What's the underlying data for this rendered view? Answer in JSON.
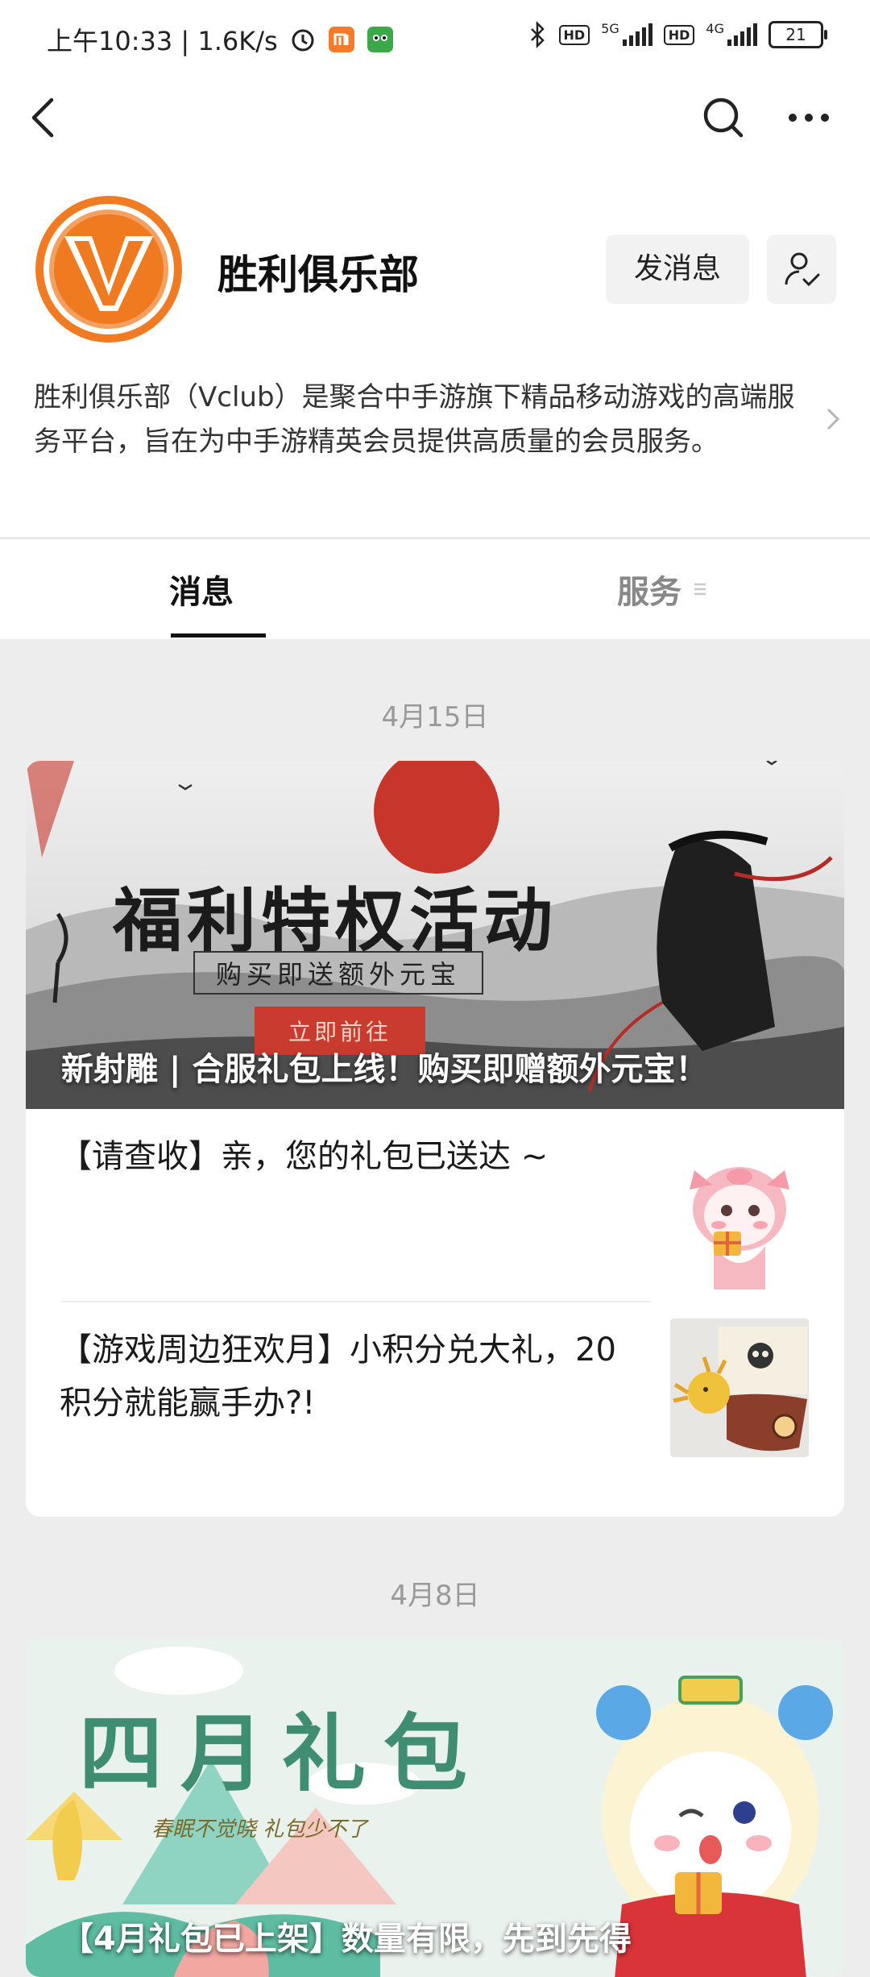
{
  "status": {
    "time_speed": "上午10:33 | 1.6K/s",
    "hd1": "HD",
    "net1": "5G",
    "hd2": "HD",
    "net2": "4G",
    "battery": "21"
  },
  "account": {
    "name": "胜利俱乐部",
    "message_button": "发消息",
    "description": "胜利俱乐部（Vclub）是聚合中手游旗下精品移动游戏的高端服务平台，旨在为中手游精英会员提供高质量的会员服务。",
    "logo_letter": "V"
  },
  "tabs": {
    "messages": "消息",
    "services": "服务"
  },
  "feed": [
    {
      "date": "4月15日",
      "banner": {
        "art_title": "福利特权活动",
        "art_subtitle": "购买即送额外元宝",
        "art_button": "立即前往",
        "caption": "新射雕 | 合服礼包上线！购买即赠额外元宝！"
      },
      "items": [
        {
          "title": "【请查收】亲，您的礼包已送达 ~"
        },
        {
          "title": "【游戏周边狂欢月】小积分兑大礼，20 积分就能赢手办?!"
        }
      ]
    },
    {
      "date": "4月8日",
      "banner": {
        "art_title": "四月礼包",
        "art_subtitle": "春眠不觉晓  礼包少不了",
        "caption": "【4月礼包已上架】数量有限，先到先得"
      }
    }
  ],
  "colors": {
    "brand_orange": "#f07b22",
    "tab_underline": "#111111",
    "feed_background": "#ededed",
    "banner_red": "#c93b2e"
  }
}
